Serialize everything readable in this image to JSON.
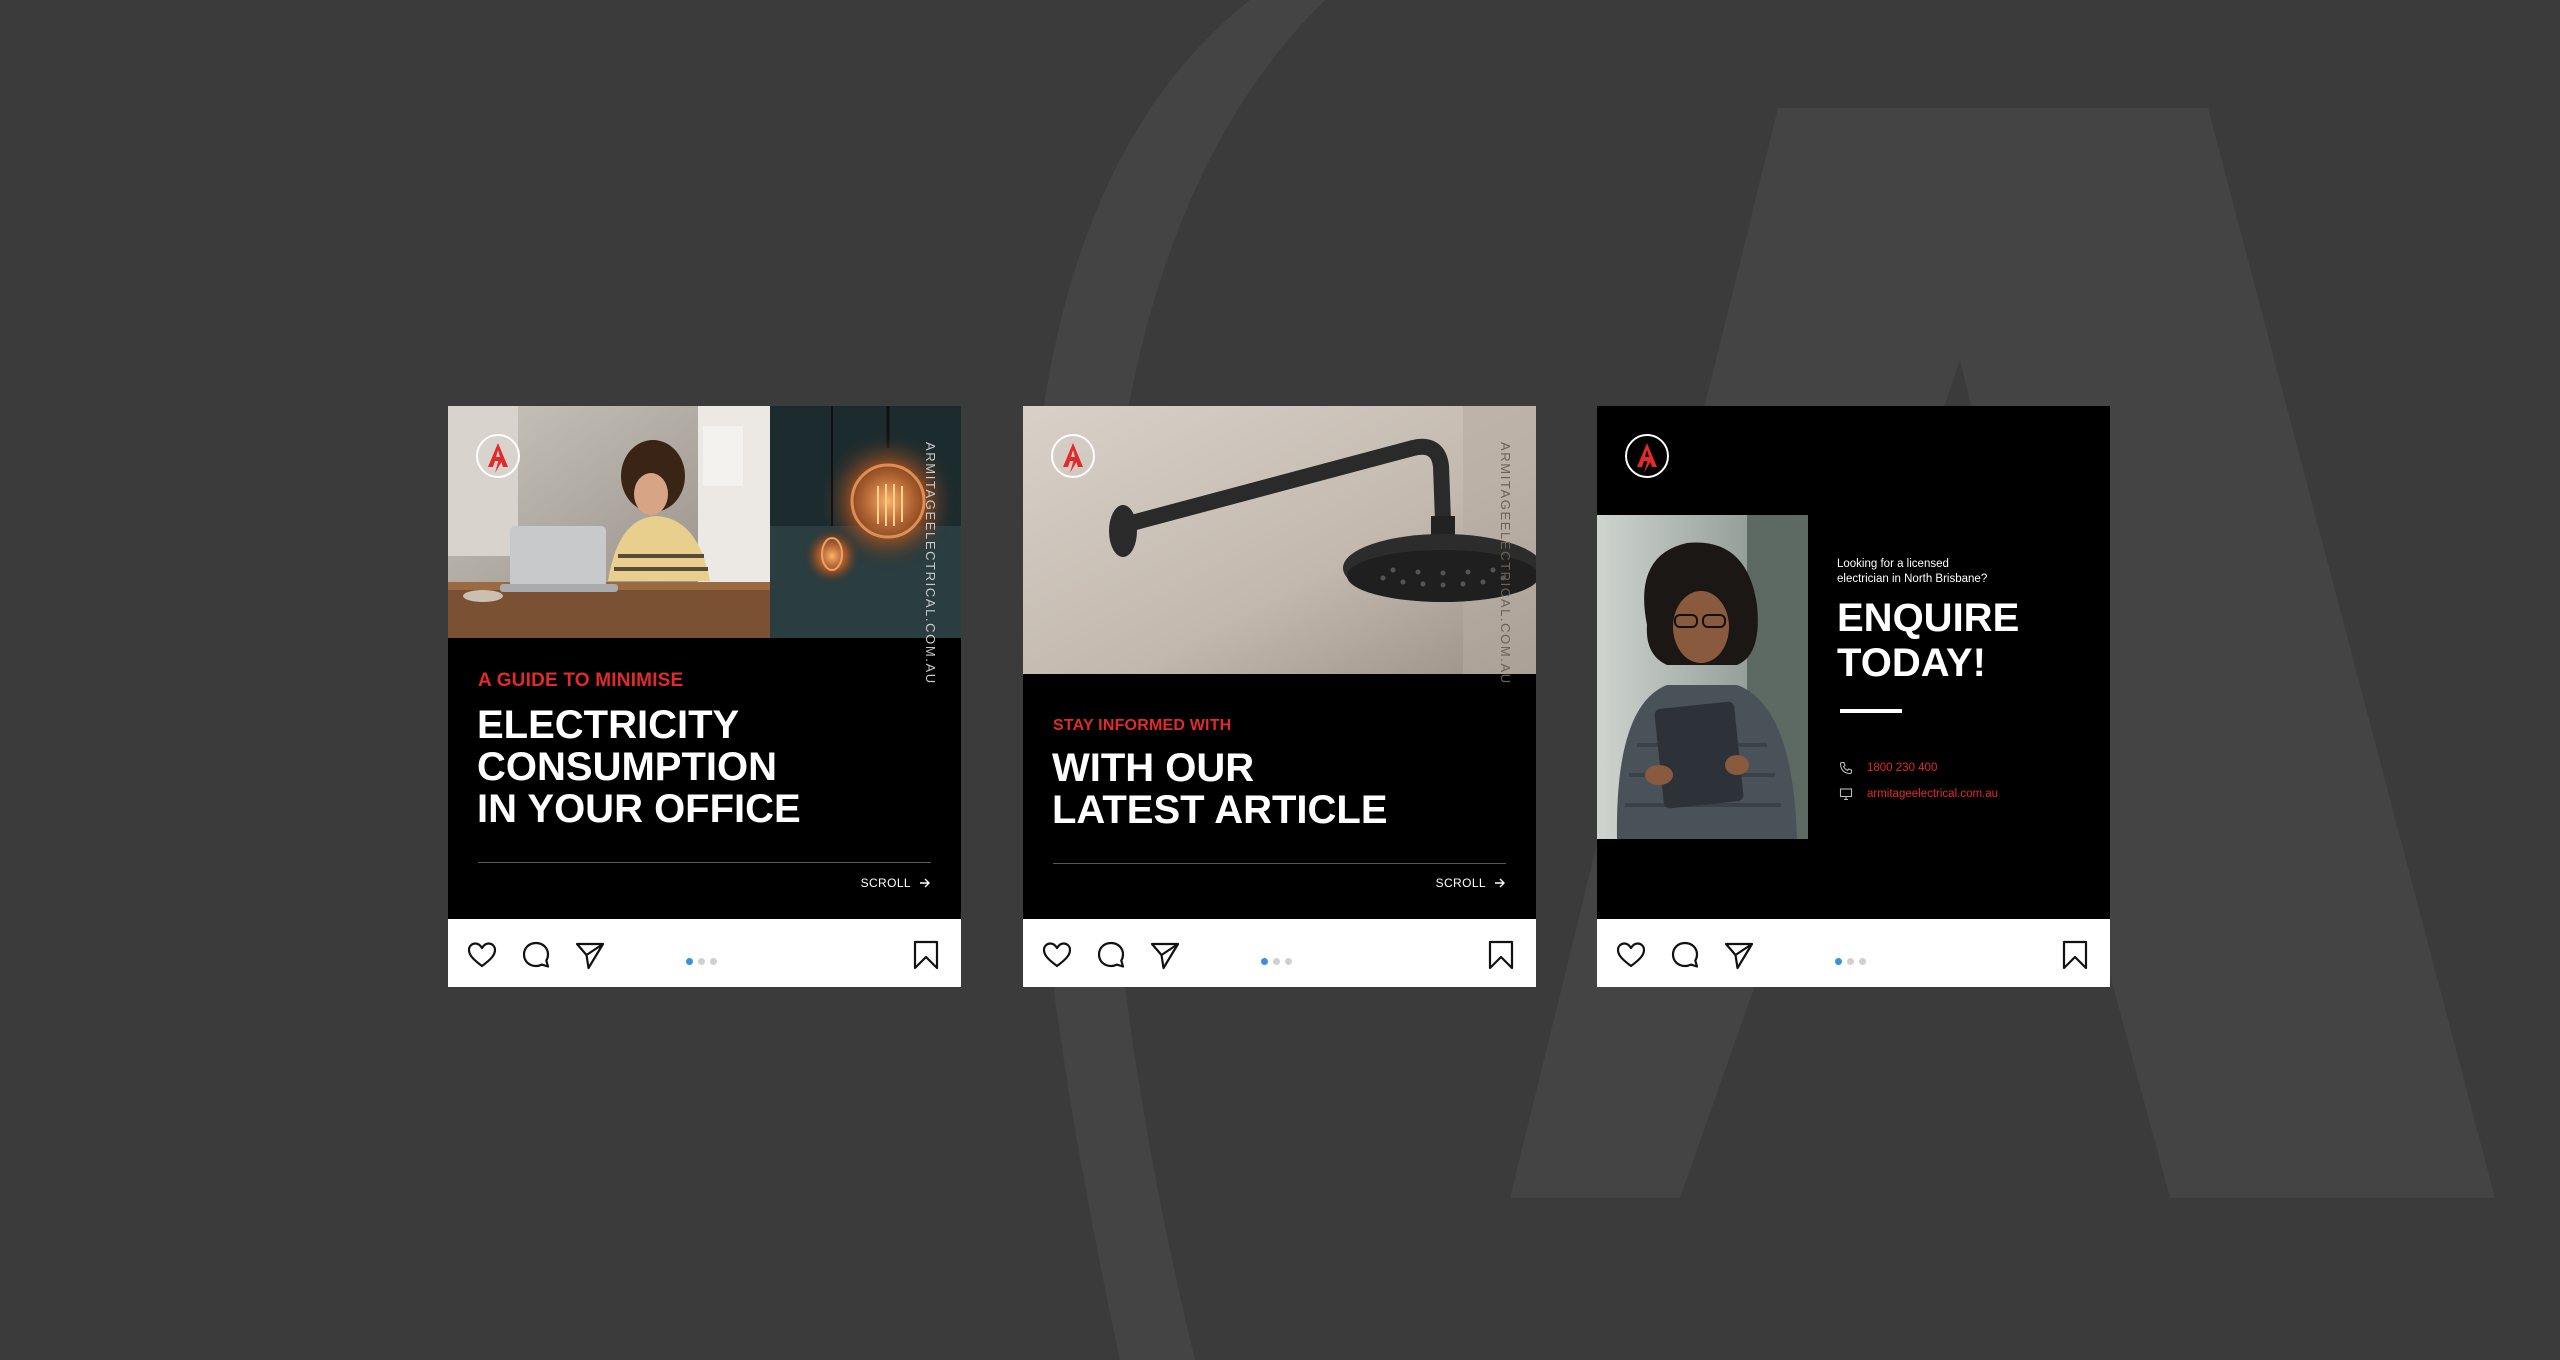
{
  "colors": {
    "background": "#3b3b3b",
    "watermark": "#444444",
    "brand_red": "#e12a2a",
    "slide_bg": "#000000",
    "dot_active": "#3b90e0",
    "dot_inactive": "#d0d0d0"
  },
  "posts": [
    {
      "vertical_url": "ARMITAGEELECTRICAL.COM.AU",
      "kicker": "A GUIDE TO MINIMISE",
      "headline": [
        "ELECTRICITY",
        "CONSUMPTION",
        "IN YOUR OFFICE"
      ],
      "scroll_label": "SCROLL",
      "carousel": {
        "count": 3,
        "active": 0
      }
    },
    {
      "vertical_url": "ARMITAGEELECTRICAL.COM.AU",
      "kicker": "STAY INFORMED WITH",
      "headline": [
        "WITH OUR",
        "LATEST ARTICLE"
      ],
      "scroll_label": "SCROLL",
      "carousel": {
        "count": 3,
        "active": 0
      }
    },
    {
      "intro": [
        "Looking for a licensed",
        "electrician in North Brisbane?"
      ],
      "headline": [
        "ENQUIRE",
        "TODAY!"
      ],
      "phone": "1800 230 400",
      "website": "armitageelectrical.com.au",
      "carousel": {
        "count": 3,
        "active": 0
      }
    }
  ],
  "icons": {
    "like": "heart-icon",
    "comment": "comment-icon",
    "share": "send-icon",
    "save": "bookmark-icon",
    "phone": "phone-icon",
    "web": "monitor-icon"
  }
}
